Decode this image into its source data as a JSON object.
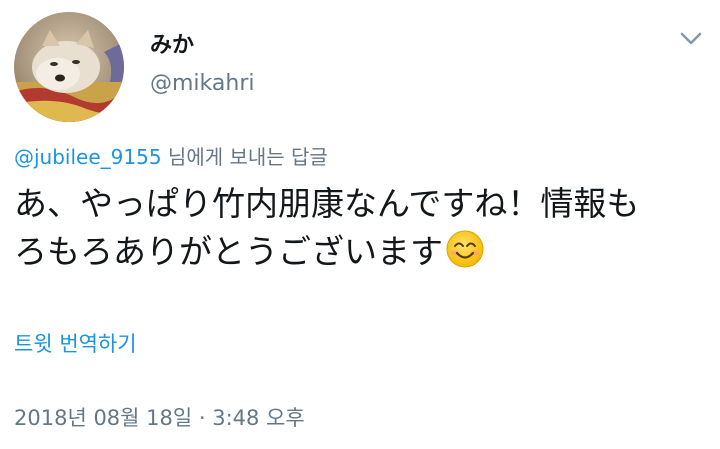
{
  "tweet": {
    "author": {
      "display_name": "みか",
      "handle": "@mikahri"
    },
    "reply": {
      "mention": "@jubilee_9155",
      "suffix": " 님에게 보내는 답글"
    },
    "text_line1": "あ、やっぱり竹内朋康なんですね！情報も",
    "text_line2": "ろもろありがとうございます",
    "emoji": "smiling-face-emoji",
    "translate_label": "트윗 번역하기",
    "timestamp": "2018년 08월 18일 · 3:48 오후"
  },
  "icons": {
    "menu": "chevron-down-icon"
  },
  "colors": {
    "link": "#1b95e0",
    "secondary_text": "#657786",
    "primary_text": "#14171a"
  }
}
